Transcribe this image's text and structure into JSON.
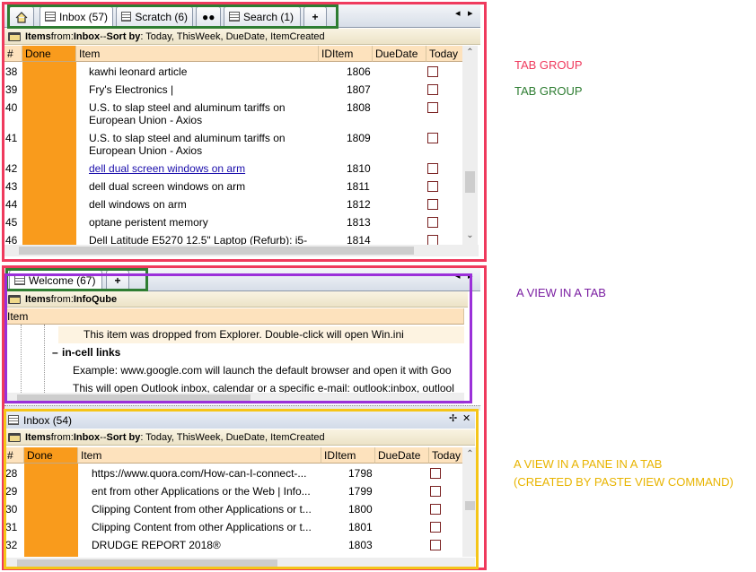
{
  "colors": {
    "red_frame": "#ef3a5d",
    "green_frame": "#2e7d32",
    "purple_frame": "#9b30d9",
    "yellow_frame": "#f5c518",
    "done_column": "#f99b1c",
    "header_bg": "#fde2bd"
  },
  "tab_group": {
    "tabs": [
      {
        "label": "Inbox (57)",
        "icon": "grid-icon"
      },
      {
        "label": "Scratch (6)",
        "icon": "grid-icon"
      },
      {
        "label": "",
        "icon": "binoculars-icon"
      },
      {
        "label": "Search (1)",
        "icon": "grid-icon"
      },
      {
        "label": "+",
        "icon": "plus-icon"
      }
    ],
    "nav_left": "◂",
    "nav_right": "▸"
  },
  "inbox_view": {
    "caption": {
      "items_label": "Items",
      "from": " from: ",
      "source": "Inbox",
      "sort_sep": " -- ",
      "sort_label": "Sort by",
      "sort_value": ": Today, ThisWeek, DueDate, ItemCreated"
    },
    "columns": [
      "#",
      "Done",
      "Item",
      "IDItem",
      "DueDate",
      "Today"
    ],
    "rows": [
      {
        "num": "38",
        "item": "kawhi leonard article",
        "item2": "",
        "id": "1806",
        "link": false
      },
      {
        "num": "39",
        "item": "Fry's Electronics |",
        "item2": "",
        "id": "1807",
        "link": false
      },
      {
        "num": "40",
        "item": "U.S. to slap steel and aluminum tariffs on",
        "item2": "European Union - Axios",
        "id": "1808",
        "link": false
      },
      {
        "num": "41",
        "item": "U.S. to slap steel and aluminum tariffs on",
        "item2": "European Union - Axios",
        "id": "1809",
        "link": false
      },
      {
        "num": "42",
        "item": "dell dual screen windows on arm",
        "item2": "",
        "id": "1810",
        "link": true
      },
      {
        "num": "43",
        "item": "dell dual screen windows on arm",
        "item2": "",
        "id": "1811",
        "link": false
      },
      {
        "num": "44",
        "item": "dell windows on arm",
        "item2": "",
        "id": "1812",
        "link": false
      },
      {
        "num": "45",
        "item": "optane peristent memory",
        "item2": "",
        "id": "1813",
        "link": false
      },
      {
        "num": "46",
        "item": "Dell Latitude E5270 12.5\" Laptop (Refurb): i5-",
        "item2": "",
        "id": "1814",
        "link": false
      }
    ]
  },
  "welcome_tab": {
    "label": "Welcome (67)",
    "plus": "+"
  },
  "infoqube_view": {
    "caption": {
      "items_label": "Items",
      "from": " from: ",
      "source": "InfoQube"
    },
    "column": "Item",
    "lines": [
      "This item was dropped from Explorer. Double-click will open Win.ini",
      "in-cell links",
      "Example: www.google.com will launch the default browser and open it with Goo",
      "This will open Outlook inbox, calendar or a specific e-mail: outlook:inbox, outlool"
    ],
    "toggle": "–"
  },
  "pane": {
    "title": "Inbox (54)",
    "pin": "✢",
    "close": "✕",
    "caption": {
      "items_label": "Items",
      "from": " from: ",
      "source": "Inbox",
      "sort_sep": " -- ",
      "sort_label": "Sort by",
      "sort_value": ": Today, ThisWeek, DueDate, ItemCreated"
    },
    "columns": [
      "#",
      "Done",
      "Item",
      "IDItem",
      "DueDate",
      "Today"
    ],
    "rows": [
      {
        "num": "28",
        "item": "https://www.quora.com/How-can-I-connect-...",
        "id": "1798"
      },
      {
        "num": "29",
        "item": "ent from other Applications or the Web | Info...",
        "id": "1799"
      },
      {
        "num": "30",
        "item": "Clipping Content from other Applications or t...",
        "id": "1800"
      },
      {
        "num": "31",
        "item": "Clipping Content from other Applications or t...",
        "id": "1801"
      },
      {
        "num": "32",
        "item": "DRUDGE REPORT 2018®",
        "id": "1803"
      }
    ]
  },
  "annotations": {
    "tab_group_red": "TAB GROUP",
    "tab_group_green": "TAB GROUP",
    "view_in_tab": "A VIEW IN A TAB",
    "view_in_pane_1": "A VIEW IN A PANE IN A TAB",
    "view_in_pane_2": "(CREATED BY PASTE VIEW COMMAND)"
  }
}
